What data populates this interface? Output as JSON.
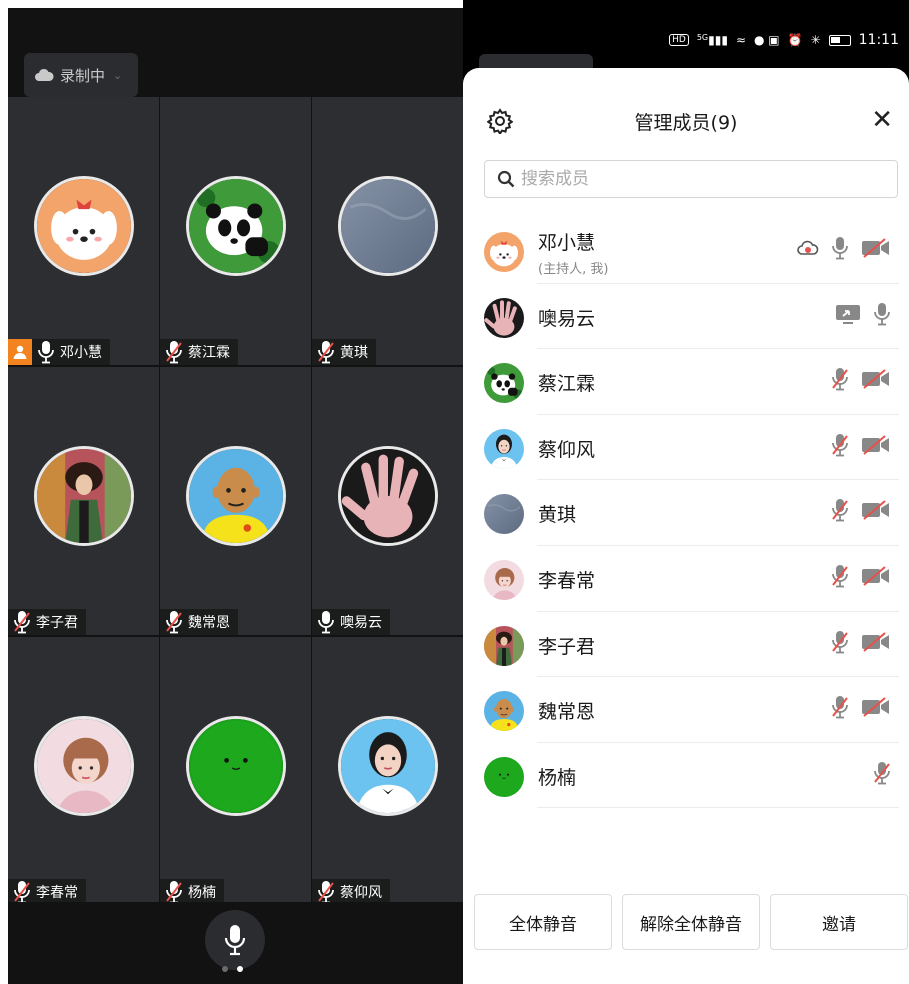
{
  "left": {
    "recording_label": "录制中",
    "tiles": [
      {
        "name": "邓小慧",
        "mic": "on",
        "host": true,
        "avatar": "cartoon-dog"
      },
      {
        "name": "蔡江霖",
        "mic": "off",
        "host": false,
        "avatar": "panda"
      },
      {
        "name": "黄琪",
        "mic": "off",
        "host": false,
        "avatar": "blue-gray"
      },
      {
        "name": "李子君",
        "mic": "off",
        "host": false,
        "avatar": "painting-woman"
      },
      {
        "name": "魏常恩",
        "mic": "off",
        "host": false,
        "avatar": "cartoon-man"
      },
      {
        "name": "噢易云",
        "mic": "on",
        "host": false,
        "avatar": "hand"
      },
      {
        "name": "李春常",
        "mic": "off",
        "host": false,
        "avatar": "girl-pink"
      },
      {
        "name": "杨楠",
        "mic": "off",
        "host": false,
        "avatar": "green-face"
      },
      {
        "name": "蔡仰风",
        "mic": "off",
        "host": false,
        "avatar": "portrait-woman"
      }
    ]
  },
  "status_bar": {
    "time": "11:11",
    "network": "5G",
    "hd": "HD"
  },
  "panel": {
    "title": "管理成员(9)",
    "search_placeholder": "搜索成员",
    "members": [
      {
        "name": "邓小慧",
        "sub": "(主持人, 我)",
        "avatar": "cartoon-dog",
        "recording": true,
        "screen": false,
        "mic": "on",
        "cam": "off"
      },
      {
        "name": "噢易云",
        "sub": "",
        "avatar": "hand",
        "recording": false,
        "screen": true,
        "mic": "on",
        "cam": "none"
      },
      {
        "name": "蔡江霖",
        "sub": "",
        "avatar": "panda",
        "recording": false,
        "screen": false,
        "mic": "off",
        "cam": "off"
      },
      {
        "name": "蔡仰风",
        "sub": "",
        "avatar": "portrait-woman",
        "recording": false,
        "screen": false,
        "mic": "off",
        "cam": "off"
      },
      {
        "name": "黄琪",
        "sub": "",
        "avatar": "blue-gray",
        "recording": false,
        "screen": false,
        "mic": "off",
        "cam": "off"
      },
      {
        "name": "李春常",
        "sub": "",
        "avatar": "girl-pink",
        "recording": false,
        "screen": false,
        "mic": "off",
        "cam": "off"
      },
      {
        "name": "李子君",
        "sub": "",
        "avatar": "painting-woman",
        "recording": false,
        "screen": false,
        "mic": "off",
        "cam": "off"
      },
      {
        "name": "魏常恩",
        "sub": "",
        "avatar": "cartoon-man",
        "recording": false,
        "screen": false,
        "mic": "off",
        "cam": "off"
      },
      {
        "name": "杨楠",
        "sub": "",
        "avatar": "green-face",
        "recording": false,
        "screen": false,
        "mic": "off",
        "cam": "none"
      }
    ],
    "buttons": {
      "mute_all": "全体静音",
      "unmute_all": "解除全体静音",
      "invite": "邀请"
    }
  }
}
